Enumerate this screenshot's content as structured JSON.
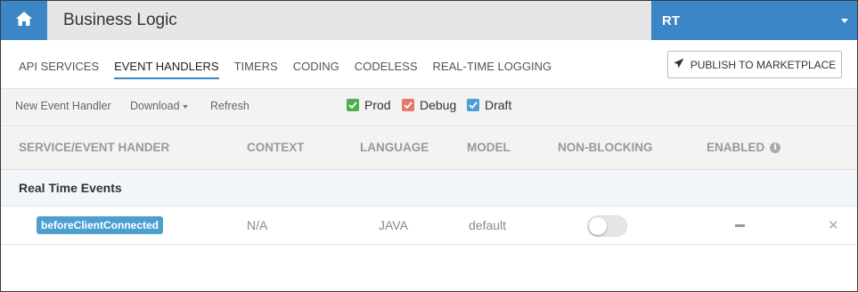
{
  "header": {
    "title": "Business Logic",
    "app_name": "RT",
    "home_icon": "home-icon",
    "accent_color": "#3a86c6"
  },
  "tabs": [
    {
      "label": "API SERVICES",
      "active": false
    },
    {
      "label": "EVENT HANDLERS",
      "active": true
    },
    {
      "label": "TIMERS",
      "active": false
    },
    {
      "label": "CODING",
      "active": false
    },
    {
      "label": "CODELESS",
      "active": false
    },
    {
      "label": "REAL-TIME LOGGING",
      "active": false
    }
  ],
  "publish_button": {
    "label": "PUBLISH TO MARKETPLACE",
    "icon": "paper-plane-icon"
  },
  "toolbar": {
    "new_label": "New Event Handler",
    "download_label": "Download",
    "refresh_label": "Refresh"
  },
  "filters": [
    {
      "label": "Prod",
      "checked": true,
      "color": "#4cae4c"
    },
    {
      "label": "Debug",
      "checked": true,
      "color": "#e8776c"
    },
    {
      "label": "Draft",
      "checked": true,
      "color": "#4c9fd1"
    }
  ],
  "table": {
    "columns": [
      "SERVICE/EVENT HANDER",
      "CONTEXT",
      "LANGUAGE",
      "MODEL",
      "NON-BLOCKING",
      "ENABLED"
    ],
    "groups": [
      {
        "label": "Real Time Events",
        "rows": [
          {
            "handler": "beforeClientConnected",
            "context": "N/A",
            "language": "JAVA",
            "model": "default",
            "non_blocking": false,
            "enabled": "—"
          }
        ]
      }
    ]
  }
}
